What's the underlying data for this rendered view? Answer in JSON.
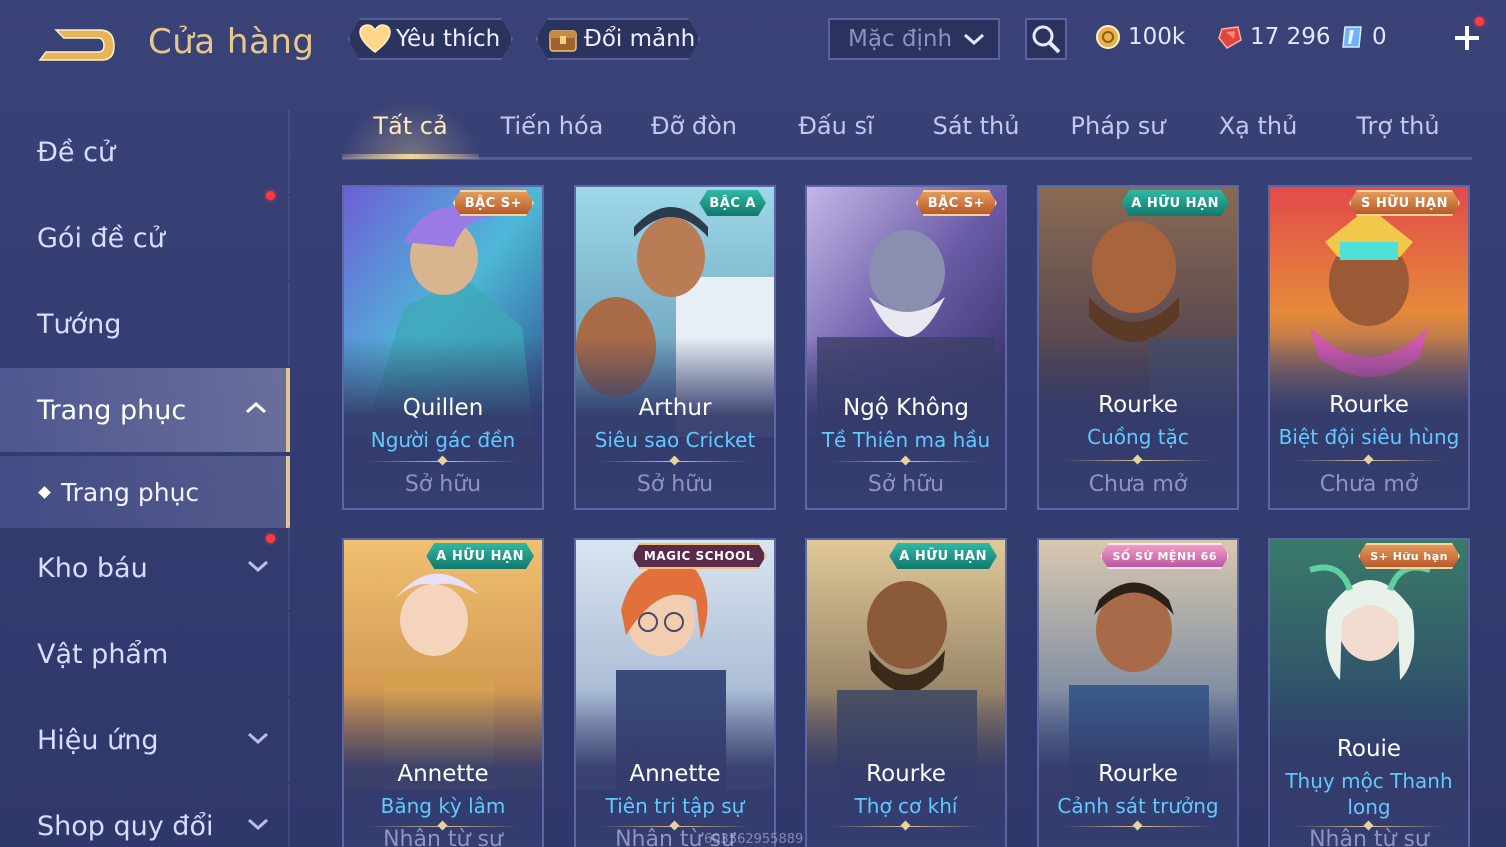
{
  "header": {
    "title": "Cửa hàng",
    "favorites_label": "Yêu thích",
    "exchange_label": "Đổi mảnh",
    "sort_value": "Mặc định",
    "gold": "100k",
    "ruby": "17 296",
    "voucher": "0"
  },
  "sidebar": {
    "items": [
      {
        "label": "Đề cử"
      },
      {
        "label": "Gói đề cử"
      },
      {
        "label": "Tướng"
      },
      {
        "label": "Trang phục"
      },
      {
        "label": "Kho báu"
      },
      {
        "label": "Vật phẩm"
      },
      {
        "label": "Hiệu ứng"
      },
      {
        "label": "Shop quy đổi"
      }
    ],
    "sub_item": "Trang phục"
  },
  "tabs": [
    "Tất cả",
    "Tiến hóa",
    "Đỡ đòn",
    "Đấu sĩ",
    "Sát thủ",
    "Pháp sư",
    "Xạ thủ",
    "Trợ thủ"
  ],
  "cards": [
    {
      "hero": "Quillen",
      "skin": "Người gác đền",
      "status": "Sở hữu",
      "badge": "BẬC S+"
    },
    {
      "hero": "Arthur",
      "skin": "Siêu sao Cricket",
      "status": "Sở hữu",
      "badge": "BẬC A"
    },
    {
      "hero": "Ngộ Không",
      "skin": "Tề Thiên ma hầu",
      "status": "Sở hữu",
      "badge": "BẬC S+"
    },
    {
      "hero": "Rourke",
      "skin": "Cuồng tặc",
      "status": "Chưa mở",
      "badge": "A HỮU HẠN"
    },
    {
      "hero": "Rourke",
      "skin": "Biệt đội siêu hùng",
      "status": "Chưa mở",
      "badge": "S HỮU HẠN"
    },
    {
      "hero": "Annette",
      "skin": "Băng kỳ lâm",
      "status": "Nhận từ sự",
      "badge": "A HỮU HẠN"
    },
    {
      "hero": "Annette",
      "skin": "Tiên tri tập sự",
      "status": "Nhận từ sự",
      "badge": "MAGIC SCHOOL"
    },
    {
      "hero": "Rourke",
      "skin": "Thợ cơ khí",
      "status": "",
      "badge": "A HỮU HẠN"
    },
    {
      "hero": "Rourke",
      "skin": "Cảnh sát trưởng",
      "status": "",
      "badge": "SỐ SỨ MỆNH 66"
    },
    {
      "hero": "Rouie",
      "skin": "Thụy mộc Thanh long",
      "status": "Nhận từ sự",
      "badge": "S+ Hữu hạn"
    }
  ],
  "watermark": "603562955889",
  "colors": {
    "background": "#363f74",
    "gold_text": "#e6c88c",
    "skin_text": "#61c9ff",
    "notification": "#ff3b3b"
  },
  "icons": [
    "back-arrow-icon",
    "heart-icon",
    "chest-icon",
    "chevron-down-icon",
    "search-icon",
    "gold-coin-icon",
    "ruby-icon",
    "voucher-icon",
    "plus-icon",
    "chevron-up-icon"
  ]
}
